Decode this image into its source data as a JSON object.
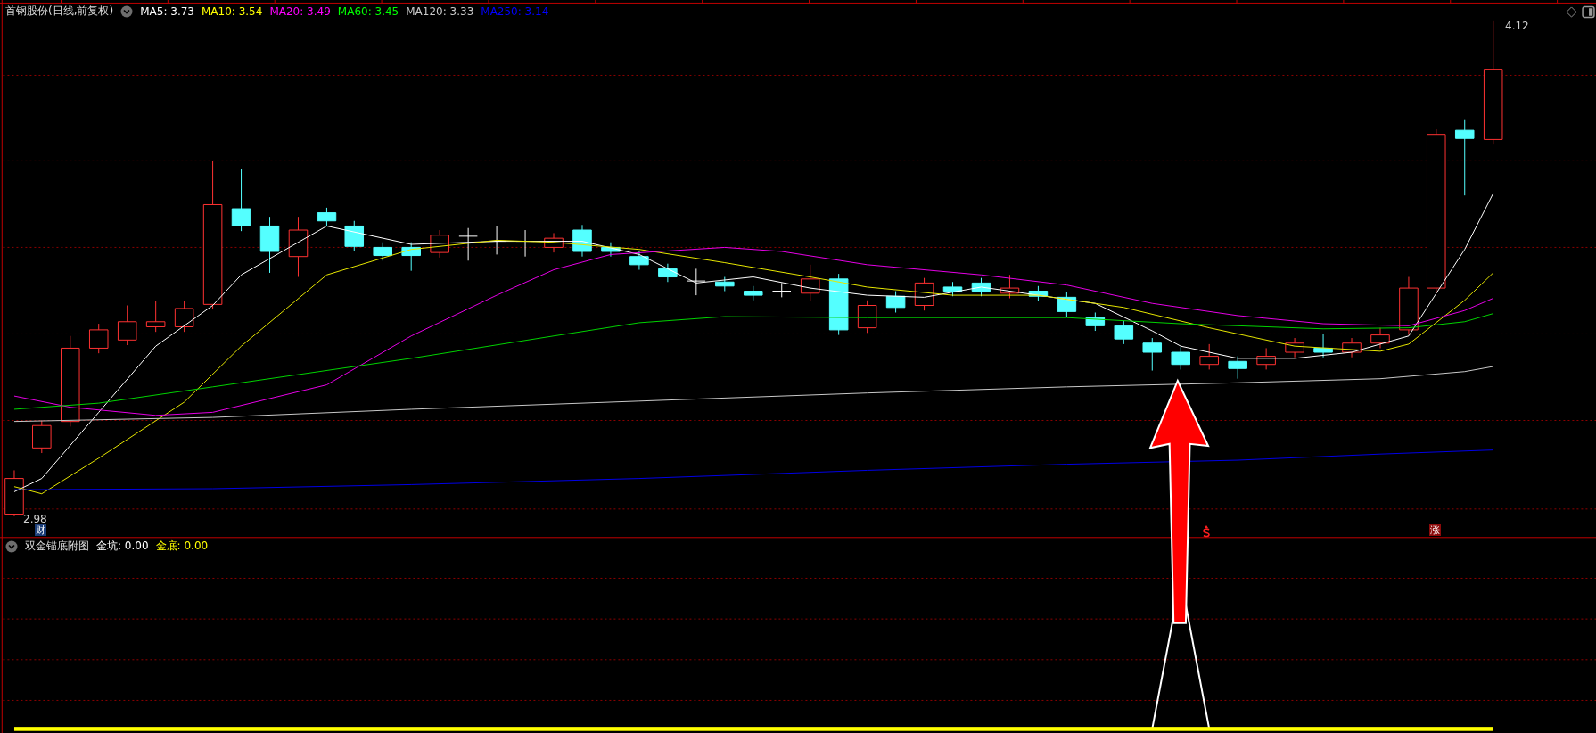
{
  "main_panel": {
    "title": "首钢股份(日线,前复权)",
    "indicators": [
      {
        "label": "MA5: 3.73",
        "color": "#ffffff"
      },
      {
        "label": "MA10: 3.54",
        "color": "#ffff00"
      },
      {
        "label": "MA20: 3.49",
        "color": "#ff00ff"
      },
      {
        "label": "MA60: 3.45",
        "color": "#00ff00"
      },
      {
        "label": "MA120: 3.33",
        "color": "#c8c8c8"
      },
      {
        "label": "MA250: 3.14",
        "color": "#0000ff"
      }
    ],
    "high_label": "4.12",
    "low_label": "2.98",
    "event_badges": [
      {
        "text": "财",
        "kind": "finance"
      },
      {
        "text": "涨",
        "kind": "limit"
      }
    ]
  },
  "sub_panel": {
    "title": "双金锚底附图",
    "indicators": [
      {
        "label": "金坑: 0.00",
        "color": "#ffffff"
      },
      {
        "label": "金底: 0.00",
        "color": "#ffff00"
      }
    ]
  }
}
